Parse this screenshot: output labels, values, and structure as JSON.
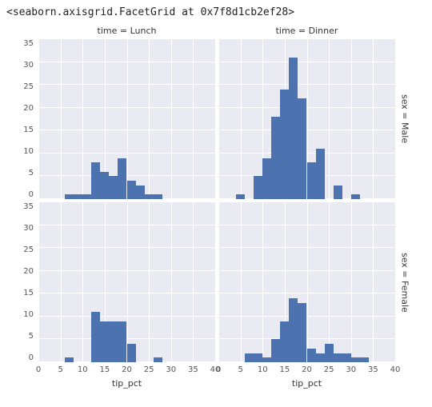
{
  "repr": "<seaborn.axisgrid.FacetGrid at 0x7f8d1cb2ef28>",
  "col_titles": [
    "time = Lunch",
    "time = Dinner"
  ],
  "row_titles": [
    "sex = Male",
    "sex = Female"
  ],
  "xlabel": "tip_pct",
  "xlim": [
    0,
    40
  ],
  "ylim": [
    0,
    35
  ],
  "yticks": [
    0,
    5,
    10,
    15,
    20,
    25,
    30,
    35
  ],
  "xticks": [
    0,
    5,
    10,
    15,
    20,
    25,
    30,
    35,
    40
  ],
  "bar_color": "#4c72b0",
  "chart_data": [
    {
      "row": "Male",
      "col": "Lunch",
      "type": "bar",
      "bin_left": [
        6,
        8,
        10,
        12,
        14,
        16,
        18,
        20,
        22,
        24,
        26
      ],
      "bin_right": [
        8,
        10,
        12,
        14,
        16,
        18,
        20,
        22,
        24,
        26,
        28
      ],
      "counts": [
        1,
        1,
        1,
        8,
        6,
        5,
        9,
        4,
        3,
        1,
        1
      ]
    },
    {
      "row": "Male",
      "col": "Dinner",
      "type": "bar",
      "bin_left": [
        4,
        8,
        10,
        12,
        14,
        16,
        18,
        20,
        22,
        26,
        30
      ],
      "bin_right": [
        6,
        10,
        12,
        14,
        16,
        18,
        20,
        22,
        24,
        28,
        32
      ],
      "counts": [
        1,
        5,
        9,
        18,
        24,
        31,
        22,
        8,
        11,
        3,
        1
      ]
    },
    {
      "row": "Female",
      "col": "Lunch",
      "type": "bar",
      "bin_left": [
        6,
        12,
        14,
        16,
        18,
        20,
        26
      ],
      "bin_right": [
        8,
        14,
        16,
        18,
        20,
        22,
        28
      ],
      "counts": [
        1,
        11,
        9,
        9,
        9,
        4,
        1
      ]
    },
    {
      "row": "Female",
      "col": "Dinner",
      "type": "bar",
      "bin_left": [
        6,
        8,
        10,
        12,
        14,
        16,
        18,
        20,
        22,
        24,
        26,
        28,
        30,
        32
      ],
      "bin_right": [
        8,
        10,
        12,
        14,
        16,
        18,
        20,
        22,
        24,
        26,
        28,
        30,
        32,
        34
      ],
      "counts": [
        2,
        2,
        1,
        5,
        9,
        14,
        13,
        3,
        2,
        4,
        2,
        2,
        1,
        1
      ]
    }
  ]
}
